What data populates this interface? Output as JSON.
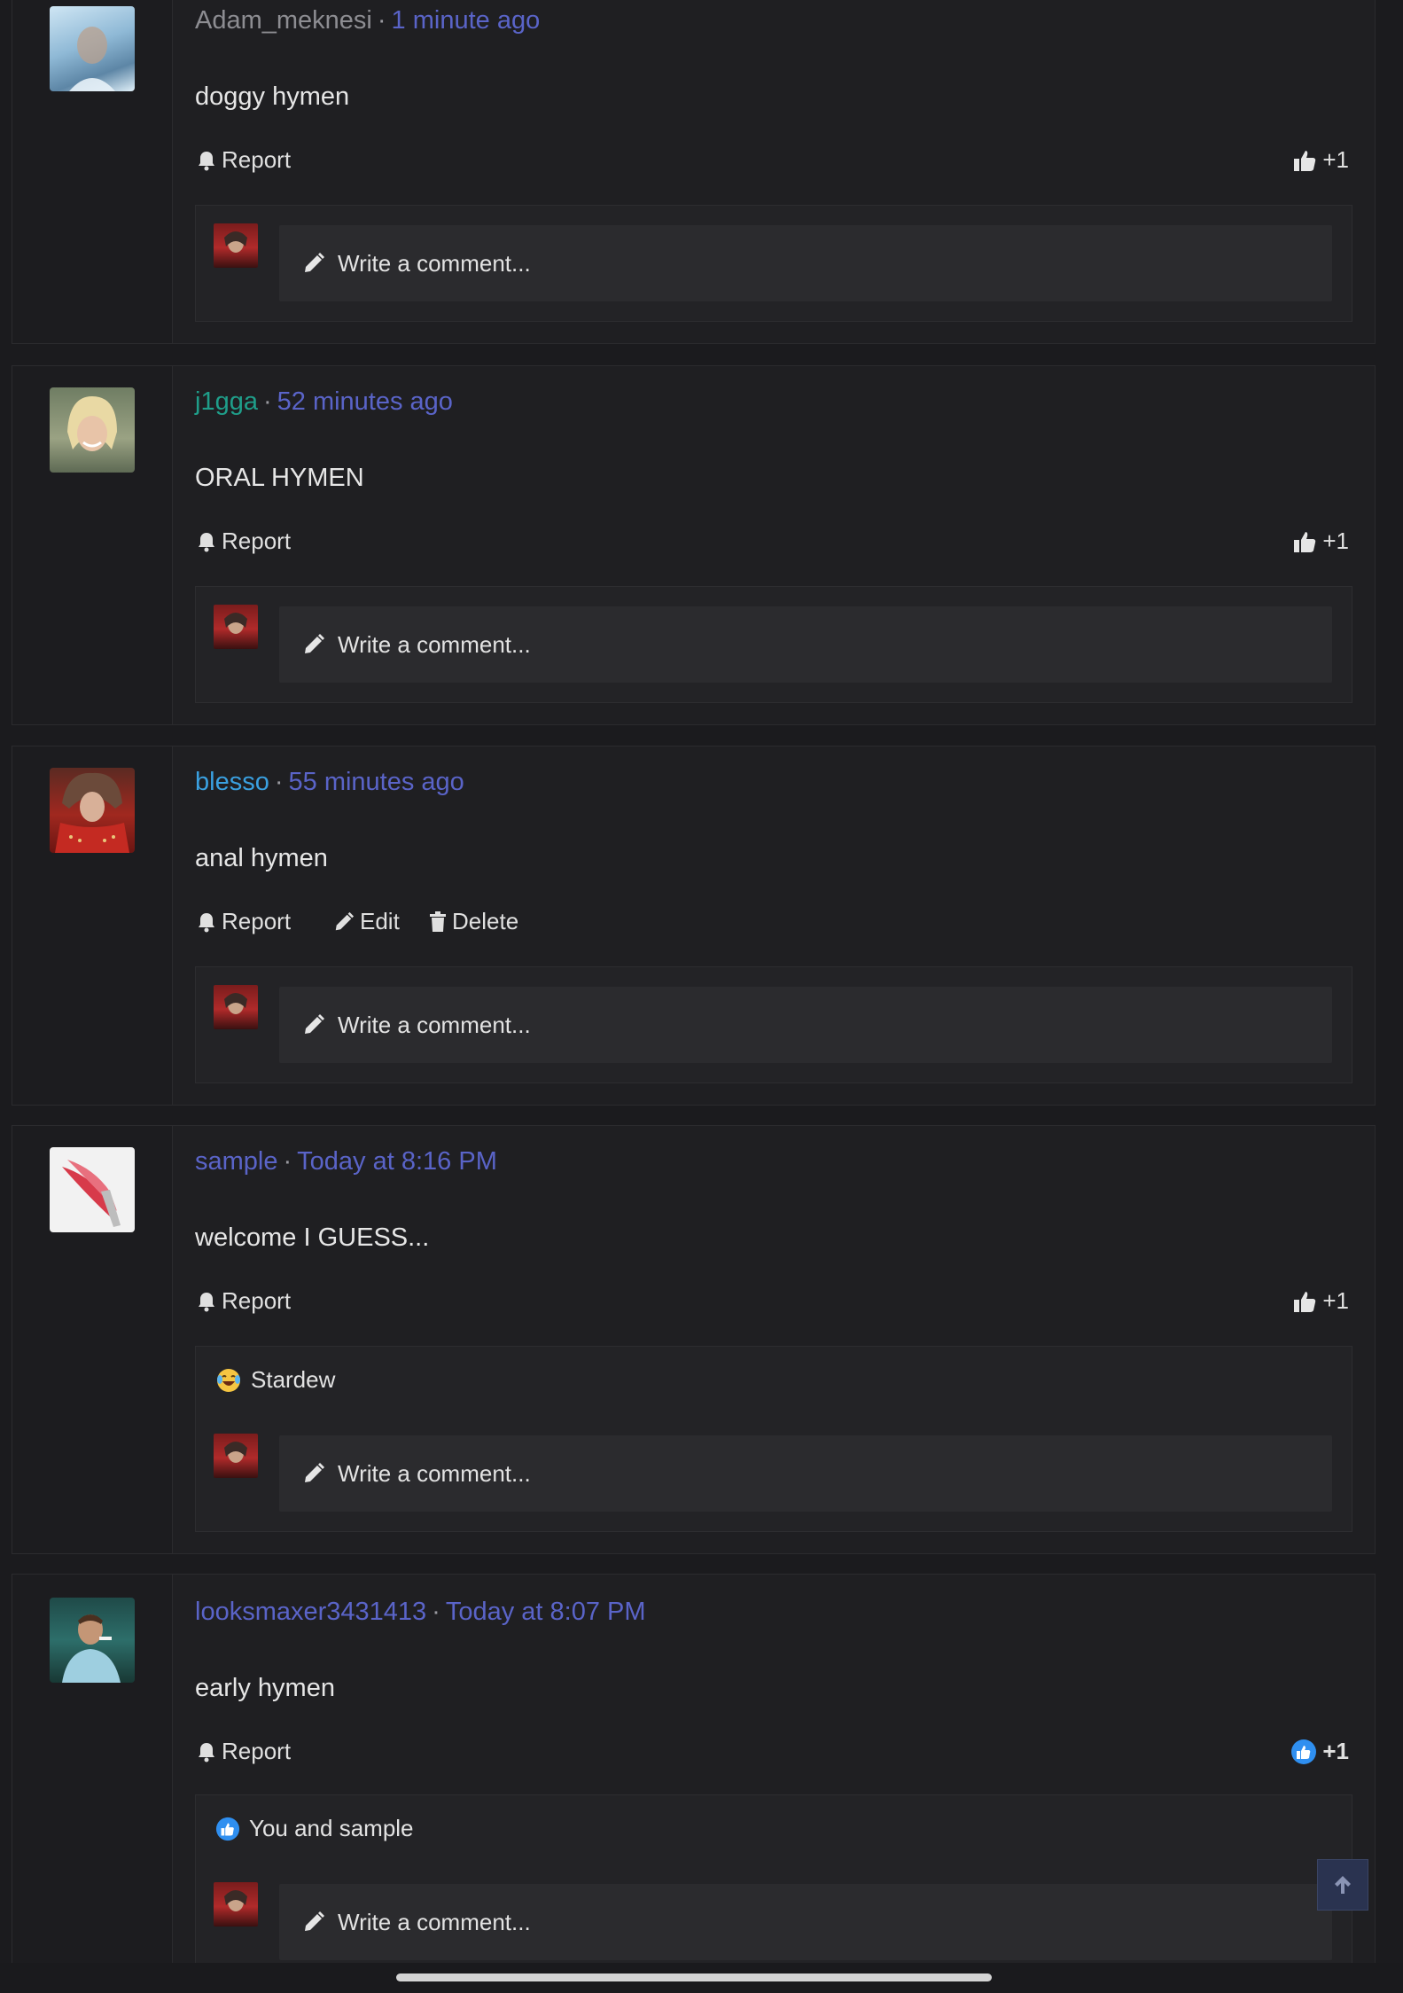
{
  "posts": [
    {
      "username": "Adam_meknesi",
      "separator": "·",
      "time": "1 minute ago",
      "message": "doggy hymen",
      "actions": {
        "report": "Report"
      },
      "likes": "+1",
      "comment_placeholder": "Write a comment..."
    },
    {
      "username": "j1gga",
      "separator": "·",
      "time": "52 minutes ago",
      "message": "ORAL HYMEN",
      "actions": {
        "report": "Report"
      },
      "likes": "+1",
      "comment_placeholder": "Write a comment..."
    },
    {
      "username": "blesso",
      "separator": "·",
      "time": "55 minutes ago",
      "message": "anal hymen",
      "actions": {
        "report": "Report",
        "edit": "Edit",
        "delete": "Delete"
      },
      "comment_placeholder": "Write a comment..."
    },
    {
      "username": "sample",
      "separator": "·",
      "time": "Today at 8:16 PM",
      "message": "welcome I GUESS...",
      "actions": {
        "report": "Report"
      },
      "likes": "+1",
      "reaction_text": "Stardew",
      "comment_placeholder": "Write a comment..."
    },
    {
      "username": "looksmaxer3431413",
      "separator": "·",
      "time": "Today at 8:07 PM",
      "message": "early hymen",
      "actions": {
        "report": "Report"
      },
      "likes": "+1",
      "reaction_text": "You and sample",
      "comment_placeholder": "Write a comment..."
    }
  ],
  "colors": {
    "background": "#1b1b1e",
    "link": "#5a64c8",
    "like_active": "#2f8ff0"
  }
}
